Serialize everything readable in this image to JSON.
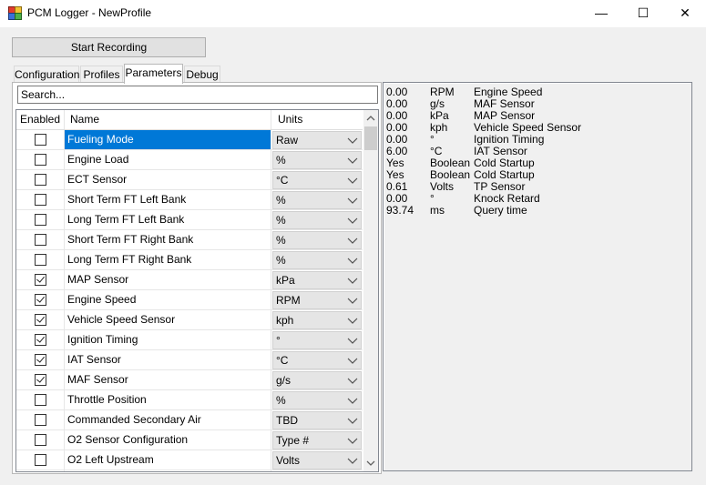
{
  "window": {
    "title": "PCM Logger - NewProfile",
    "minimize_glyph": "—",
    "maximize_glyph": "☐",
    "close_glyph": "✕"
  },
  "toolbar": {
    "record_label": "Start Recording"
  },
  "tabs": [
    {
      "label": "Configuration"
    },
    {
      "label": "Profiles"
    },
    {
      "label": "Parameters",
      "active": true
    },
    {
      "label": "Debug"
    }
  ],
  "search": {
    "placeholder": "Search..."
  },
  "grid": {
    "headers": {
      "enabled": "Enabled",
      "name": "Name",
      "units": "Units"
    },
    "rows": [
      {
        "enabled": false,
        "name": "Fueling Mode",
        "units": "Raw",
        "selected": true
      },
      {
        "enabled": false,
        "name": "Engine Load",
        "units": "%"
      },
      {
        "enabled": false,
        "name": "ECT Sensor",
        "units": "°C"
      },
      {
        "enabled": false,
        "name": "Short Term FT Left Bank",
        "units": "%"
      },
      {
        "enabled": false,
        "name": "Long Term FT Left Bank",
        "units": "%"
      },
      {
        "enabled": false,
        "name": "Short Term FT Right Bank",
        "units": "%"
      },
      {
        "enabled": false,
        "name": "Long Term FT Right Bank",
        "units": "%"
      },
      {
        "enabled": true,
        "name": "MAP Sensor",
        "units": "kPa"
      },
      {
        "enabled": true,
        "name": "Engine Speed",
        "units": "RPM"
      },
      {
        "enabled": true,
        "name": "Vehicle Speed Sensor",
        "units": "kph"
      },
      {
        "enabled": true,
        "name": "Ignition Timing",
        "units": "°"
      },
      {
        "enabled": true,
        "name": "IAT Sensor",
        "units": "°C"
      },
      {
        "enabled": true,
        "name": "MAF Sensor",
        "units": "g/s"
      },
      {
        "enabled": false,
        "name": "Throttle Position",
        "units": "%"
      },
      {
        "enabled": false,
        "name": "Commanded Secondary Air",
        "units": "TBD"
      },
      {
        "enabled": false,
        "name": "O2 Sensor Configuration",
        "units": "Type #"
      },
      {
        "enabled": false,
        "name": "O2 Left Upstream",
        "units": "Volts"
      },
      {
        "enabled": false,
        "name": "",
        "units": ""
      }
    ]
  },
  "output": {
    "lines": [
      {
        "value": "0.00",
        "unit": "RPM",
        "name": "Engine Speed"
      },
      {
        "value": "0.00",
        "unit": "g/s",
        "name": "MAF Sensor"
      },
      {
        "value": "0.00",
        "unit": "kPa",
        "name": "MAP Sensor"
      },
      {
        "value": "0.00",
        "unit": "kph",
        "name": "Vehicle Speed Sensor"
      },
      {
        "value": "0.00",
        "unit": "°",
        "name": "Ignition Timing"
      },
      {
        "value": "6.00",
        "unit": "°C",
        "name": "IAT Sensor"
      },
      {
        "value": "Yes",
        "unit": "Boolean",
        "name": "Cold Startup"
      },
      {
        "value": "Yes",
        "unit": "Boolean",
        "name": "Cold Startup"
      },
      {
        "value": "0.61",
        "unit": "Volts",
        "name": "TP Sensor"
      },
      {
        "value": "0.00",
        "unit": "°",
        "name": "Knock Retard"
      },
      {
        "value": "93.74",
        "unit": "ms",
        "name": "Query time"
      }
    ]
  },
  "colors": {
    "selection": "#0078d7",
    "window_bg": "#f0f0f0"
  }
}
